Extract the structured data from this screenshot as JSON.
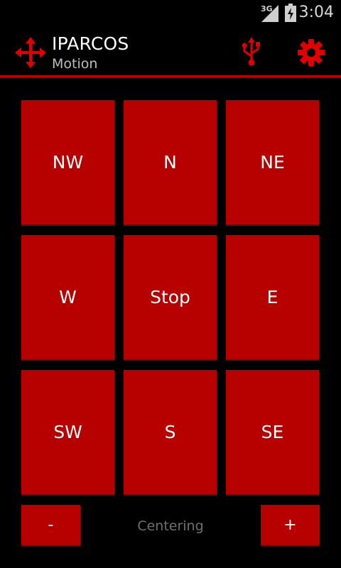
{
  "status_bar": {
    "network_type": "3G",
    "time": "3:04",
    "icons": [
      "signal-icon",
      "battery-charging-icon"
    ]
  },
  "action_bar": {
    "app_icon": "move-arrows-icon",
    "title": "IPARCOS",
    "subtitle": "Motion",
    "actions": [
      "usb-icon",
      "gear-icon"
    ]
  },
  "directions": {
    "nw": "NW",
    "n": "N",
    "ne": "NE",
    "w": "W",
    "stop": "Stop",
    "e": "E",
    "sw": "SW",
    "s": "S",
    "se": "SE"
  },
  "centering": {
    "minus_label": "-",
    "label": "Centering",
    "plus_label": "+"
  },
  "colors": {
    "accent": "#c00000",
    "button": "#b70000",
    "background": "#000000"
  }
}
